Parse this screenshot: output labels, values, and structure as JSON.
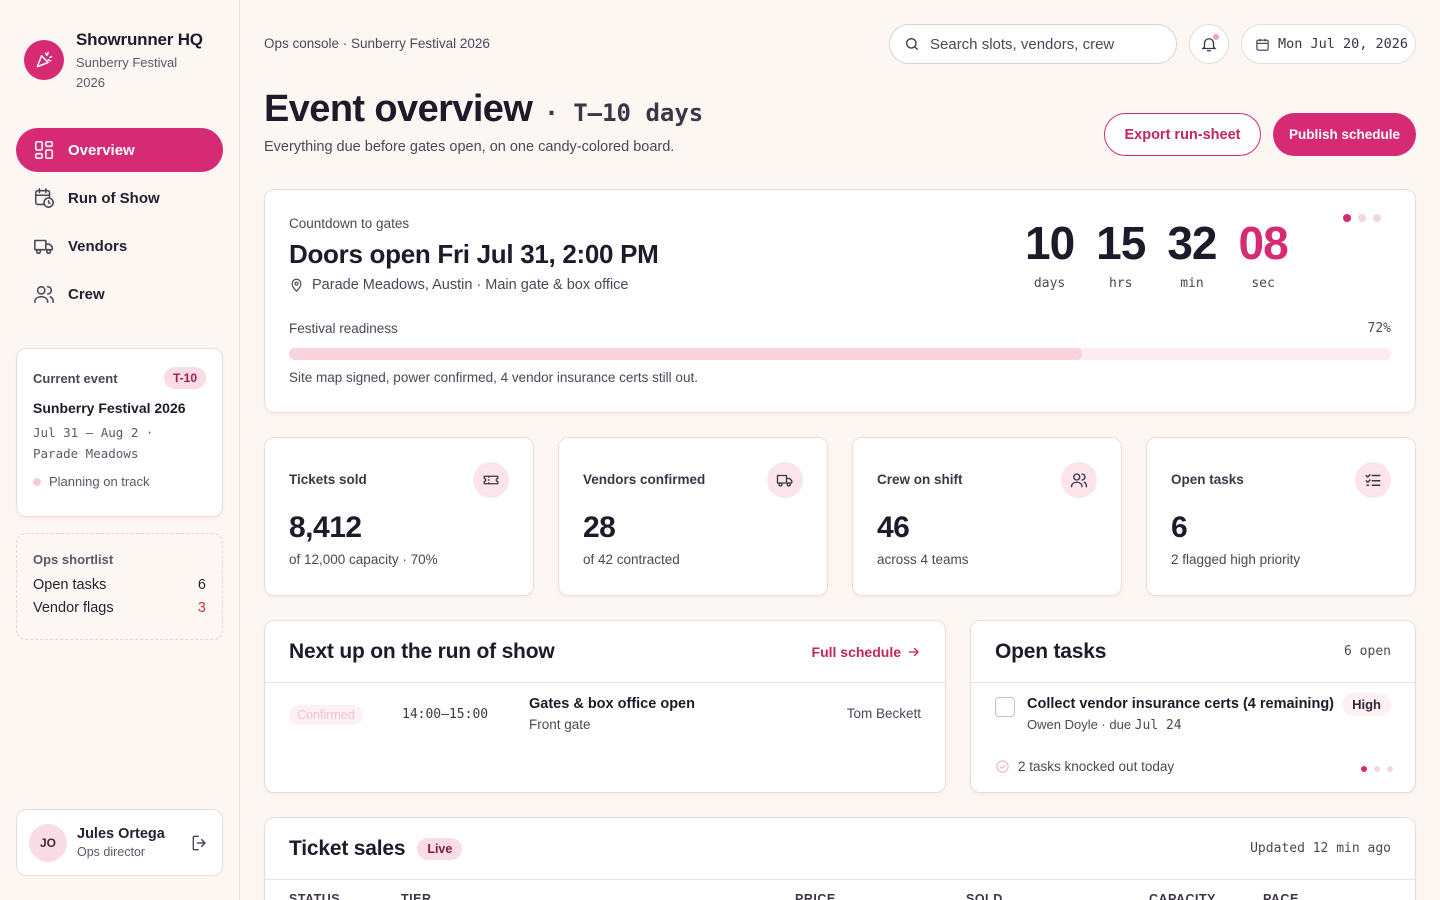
{
  "brand": {
    "title": "Showrunner HQ",
    "subtitle": "Sunberry Festival 2026"
  },
  "nav": [
    {
      "label": "Overview",
      "icon": "dashboard-icon",
      "active": true
    },
    {
      "label": "Run of Show",
      "icon": "calendar-clock-icon",
      "active": false
    },
    {
      "label": "Vendors",
      "icon": "truck-icon",
      "active": false
    },
    {
      "label": "Crew",
      "icon": "users-icon",
      "active": false
    }
  ],
  "current_event": {
    "label": "Current event",
    "badge": "T-10",
    "name": "Sunberry Festival 2026",
    "dates": "Jul 31 – Aug 2 ·",
    "venue": "Parade Meadows",
    "status": "Planning on track"
  },
  "shortlist": {
    "title": "Ops shortlist",
    "rows": [
      {
        "label": "Open tasks",
        "value": "6"
      },
      {
        "label": "Vendor flags",
        "value": "3"
      }
    ]
  },
  "user": {
    "initials": "JO",
    "name": "Jules Ortega",
    "role": "Ops director"
  },
  "topbar": {
    "breadcrumb": "Ops console · Sunberry Festival 2026",
    "search_placeholder": "Search slots, vendors, crew",
    "date": "Mon Jul 20, 2026"
  },
  "header": {
    "title": "Event overview",
    "tminus": "· T–10 days",
    "subtitle": "Everything due before gates open, on one candy-colored board.",
    "export_label": "Export run-sheet",
    "publish_label": "Publish schedule"
  },
  "countdown": {
    "label": "Countdown to gates",
    "title": "Doors open Fri Jul 31, 2:00 PM",
    "location": "Parade Meadows, Austin · Main gate & box office",
    "days": "10",
    "days_label": "days",
    "hrs": "15",
    "hrs_label": "hrs",
    "min": "32",
    "min_label": "min",
    "sec": "08",
    "sec_label": "sec",
    "readiness_label": "Festival readiness",
    "readiness_pct_text": "72%",
    "readiness_value": 0.72,
    "readiness_note": "Site map signed, power confirmed, 4 vendor insurance certs still out."
  },
  "stats": [
    {
      "label": "Tickets sold",
      "value": "8,412",
      "sub": "of 12,000 capacity · 70%",
      "icon": "ticket-icon"
    },
    {
      "label": "Vendors confirmed",
      "value": "28",
      "sub": "of 42 contracted",
      "icon": "truck-icon"
    },
    {
      "label": "Crew on shift",
      "value": "46",
      "sub": "across 4 teams",
      "icon": "users-icon"
    },
    {
      "label": "Open tasks",
      "value": "6",
      "sub": "2 flagged high priority",
      "icon": "checklist-icon"
    }
  ],
  "run_of_show": {
    "title": "Next up on the run of show",
    "link": "Full schedule",
    "rows": [
      {
        "status": "Confirmed",
        "time": "14:00–15:00",
        "title": "Gates & box office open",
        "location": "Front gate",
        "owner": "Tom Beckett"
      }
    ]
  },
  "tasks": {
    "title": "Open tasks",
    "count": "6 open",
    "items": [
      {
        "title": "Collect vendor insurance certs (4 remaining)",
        "owner": "Owen Doyle · due ",
        "due": "Jul 24",
        "priority": "High"
      }
    ],
    "footer": "2 tasks knocked out today"
  },
  "sales": {
    "title": "Ticket sales",
    "badge": "Live",
    "updated": "Updated 12 min ago",
    "columns": [
      "STATUS",
      "TIER",
      "PRICE",
      "SOLD",
      "CAPACITY",
      "PACE"
    ]
  },
  "colors": {
    "accent": "#d62b74",
    "accent_soft": "#fbdce4",
    "bg": "#fdf7f3"
  }
}
